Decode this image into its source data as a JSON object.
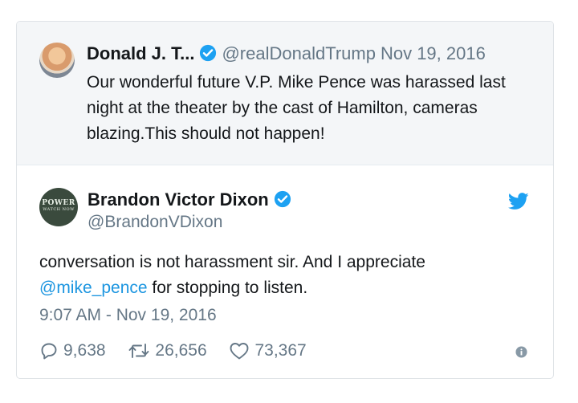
{
  "quoted_tweet": {
    "name": "Donald J. T...",
    "handle": "@realDonaldTrump",
    "date": "Nov 19, 2016",
    "text": "Our wonderful future V.P. Mike Pence was harassed last night at the theater by the cast of Hamilton, cameras blazing.This should not happen!"
  },
  "tweet": {
    "avatar_text": [
      "POWER",
      "WATCH NOW"
    ],
    "name": "Brandon Victor Dixon",
    "handle": "@BrandonVDixon",
    "text_before": "conversation is not harassment sir. And I appreciate ",
    "mention": "@mike_pence",
    "text_after": " for stopping to listen.",
    "timestamp": "9:07 AM - Nov 19, 2016",
    "replies": "9,638",
    "retweets": "26,656",
    "likes": "73,367"
  },
  "colors": {
    "accent": "#1da1f2",
    "link": "#1b95e0",
    "muted": "#657786",
    "quote_bg": "#f4f6f8"
  },
  "icons": [
    "verified-badge-icon",
    "twitter-bird-icon",
    "reply-icon",
    "retweet-icon",
    "heart-icon",
    "info-icon"
  ]
}
